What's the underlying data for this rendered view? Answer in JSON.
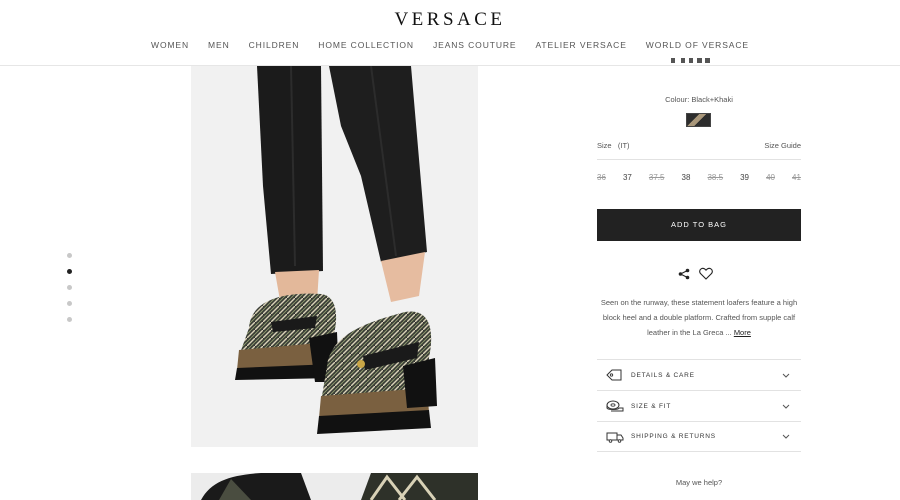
{
  "brand": {
    "logo": "VERSACE"
  },
  "nav": [
    "WOMEN",
    "MEN",
    "CHILDREN",
    "HOME COLLECTION",
    "JEANS COUTURE",
    "ATELIER VERSACE",
    "WORLD OF VERSACE"
  ],
  "carousel": {
    "total": 5,
    "active": 2
  },
  "product": {
    "colour_label": "Colour: Black+Khaki",
    "size_label": "Size",
    "size_system": "(IT)",
    "size_guide": "Size Guide",
    "sizes": [
      {
        "label": "36",
        "available": false
      },
      {
        "label": "37",
        "available": true
      },
      {
        "label": "37.5",
        "available": false
      },
      {
        "label": "38",
        "available": true
      },
      {
        "label": "38.5",
        "available": false
      },
      {
        "label": "39",
        "available": true
      },
      {
        "label": "40",
        "available": false
      },
      {
        "label": "41",
        "available": false
      }
    ],
    "add_to_bag": "ADD TO BAG",
    "description": "Seen on the runway, these statement loafers feature a high block heel and a double platform. Crafted from supple calf leather in the La Greca ...",
    "more_link": "More",
    "accordion": [
      {
        "label": "DETAILS & CARE",
        "icon": "tag-icon"
      },
      {
        "label": "SIZE & FIT",
        "icon": "measuring-tape-icon"
      },
      {
        "label": "SHIPPING & RETURNS",
        "icon": "truck-icon"
      }
    ],
    "help": "May we help?"
  },
  "colors": {
    "button_bg": "#222222",
    "swatch_dark": "#2d2d2d",
    "swatch_khaki": "#a9977a"
  }
}
